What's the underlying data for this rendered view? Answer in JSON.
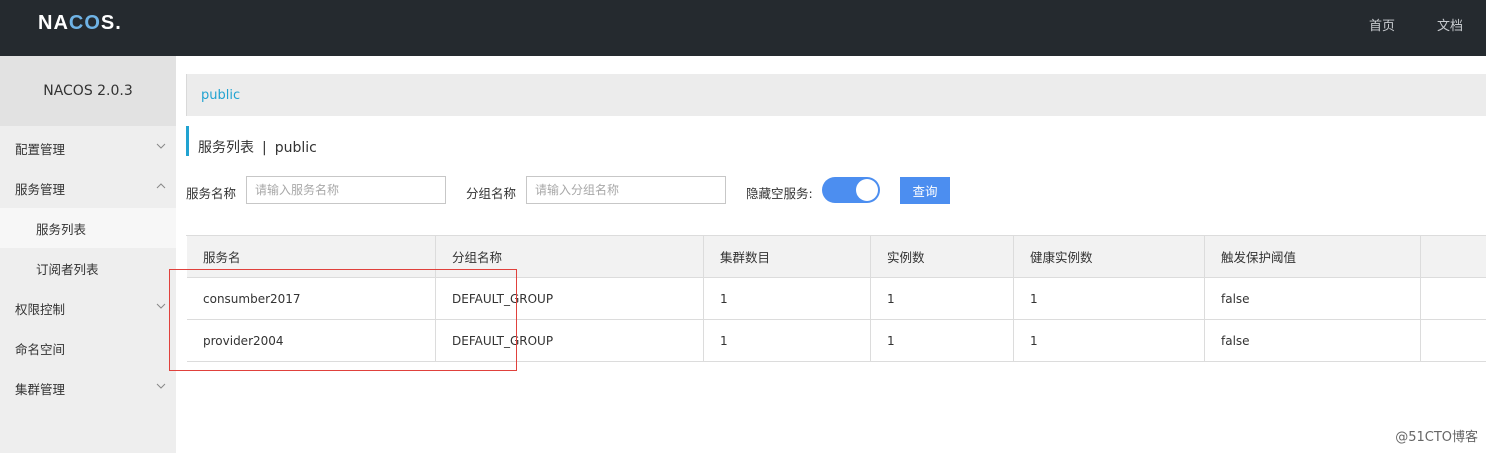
{
  "header": {
    "logo": {
      "part1": "NA",
      "part2": "CO",
      "part3": "S."
    },
    "nav": [
      "首页",
      "文档"
    ]
  },
  "sidebar": {
    "version": "NACOS 2.0.3",
    "items": [
      {
        "label": "配置管理",
        "expanded": false,
        "has_chevron": true
      },
      {
        "label": "服务管理",
        "expanded": true,
        "has_chevron": true
      },
      {
        "label": "服务列表",
        "sub": true,
        "active": true
      },
      {
        "label": "订阅者列表",
        "sub": true
      },
      {
        "label": "权限控制",
        "expanded": false,
        "has_chevron": true
      },
      {
        "label": "命名空间",
        "has_chevron": false
      },
      {
        "label": "集群管理",
        "expanded": false,
        "has_chevron": true
      }
    ]
  },
  "main": {
    "breadcrumb": "public",
    "title": {
      "text": "服务列表",
      "separator": "|",
      "namespace": "public"
    },
    "filters": {
      "service_name_label": "服务名称",
      "service_name_placeholder": "请输入服务名称",
      "group_name_label": "分组名称",
      "group_name_placeholder": "请输入分组名称",
      "hide_empty_label": "隐藏空服务:",
      "hide_empty_on": true,
      "query_label": "查询"
    },
    "table": {
      "columns": [
        "服务名",
        "分组名称",
        "集群数目",
        "实例数",
        "健康实例数",
        "触发保护阈值",
        ""
      ],
      "rows": [
        [
          "consumber2017",
          "DEFAULT_GROUP",
          "1",
          "1",
          "1",
          "false",
          ""
        ],
        [
          "provider2004",
          "DEFAULT_GROUP",
          "1",
          "1",
          "1",
          "false",
          ""
        ]
      ]
    }
  },
  "watermark": "@51CTO博客",
  "colors": {
    "topbar": "#252a2f",
    "accent": "#21a3d1",
    "primary": "#4c8ef0",
    "highlight": "#e0413c"
  }
}
